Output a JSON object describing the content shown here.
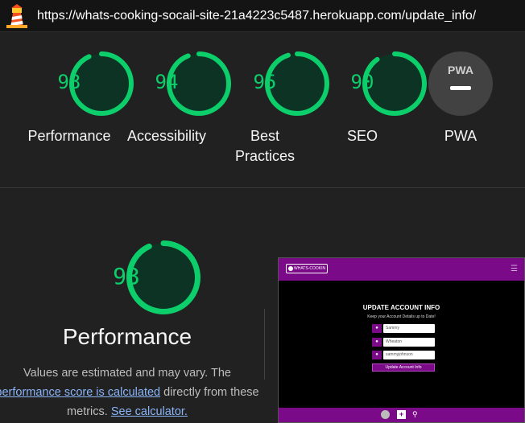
{
  "browser": {
    "url": "https://whats-cooking-socail-site-21a4223c5487.herokuapp.com/update_info/",
    "logo_icon": "lighthouse-icon"
  },
  "colors": {
    "pass": "#0cce6b",
    "pass_bg": "#0c3323",
    "pwa_bg": "#424242",
    "brand": "#7b0a88"
  },
  "scores": [
    {
      "label": "Performance",
      "value": "93",
      "score": 93
    },
    {
      "label": "Accessibility",
      "value": "94",
      "score": 94
    },
    {
      "label": "Best Practices",
      "value": "95",
      "score": 95
    },
    {
      "label": "SEO",
      "value": "90",
      "score": 90
    }
  ],
  "pwa": {
    "label": "PWA",
    "badge": "PWA"
  },
  "performance": {
    "value": "93",
    "score": 93,
    "title": "Performance",
    "desc_1": "Values are estimated and may vary. The",
    "link_1": "performance score is calculated",
    "desc_2": "directly from these",
    "desc_3": "metrics.",
    "link_2": "See calculator."
  },
  "preview": {
    "brand": "WHATS-COOKIN",
    "heading": "UPDATE ACCOUNT INFO",
    "subheading": "Keep your Account Details up to Date!",
    "fields": [
      "Sammy",
      "Wheaton",
      "sammyjohnson"
    ],
    "button": "Update Account Info",
    "menu_icon": "hamburger-icon",
    "field_icon": "user-icon"
  }
}
